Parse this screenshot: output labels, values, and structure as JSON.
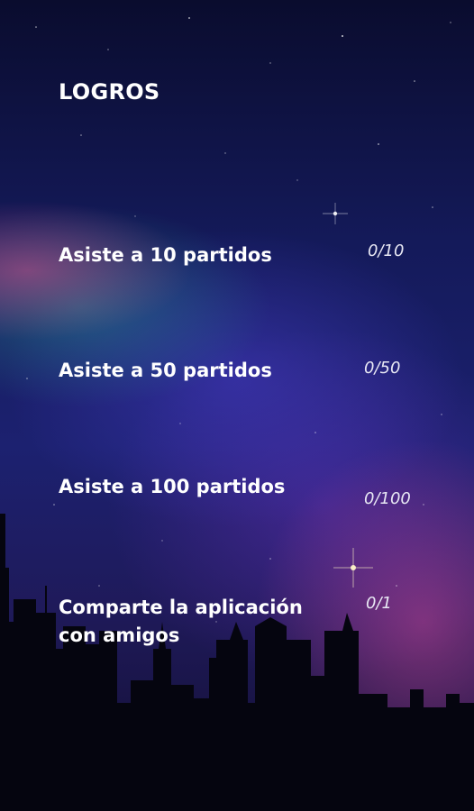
{
  "screen": {
    "title": "LOGROS"
  },
  "achievements": [
    {
      "label": "Asiste a 10 partidos",
      "progress": "0/10",
      "current": 0,
      "target": 10
    },
    {
      "label": "Asiste a 50 partidos",
      "progress": "0/50",
      "current": 0,
      "target": 50
    },
    {
      "label": "Asiste a 100 partidos",
      "progress": "0/100",
      "current": 0,
      "target": 100
    },
    {
      "label": "Comparte la aplicación con amigos",
      "progress": "0/1",
      "current": 0,
      "target": 1
    }
  ],
  "colors": {
    "text": "#ffffff",
    "sky_top": "#0a0c2e",
    "sky_mid": "#1c2170",
    "nebula_pink": "#d2508c",
    "nebula_teal": "#28a096",
    "skyline": "#05050f"
  },
  "background": {
    "icon": "night-city-skyline-with-nebula"
  }
}
